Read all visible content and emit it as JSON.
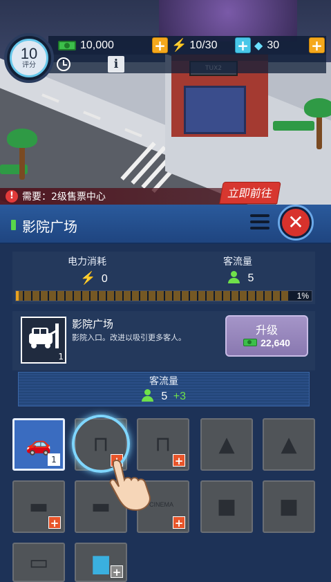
{
  "hud": {
    "rating_value": "10",
    "rating_label": "评分",
    "cash": "10,000",
    "energy": "10/30",
    "gems": "30",
    "info_symbol": "i"
  },
  "requirement": {
    "text": "需要：2级售票中心",
    "go_label": "立即前往"
  },
  "panel": {
    "title": "影院广场",
    "stats": {
      "power_label": "电力消耗",
      "power_value": "0",
      "visitors_label": "客流量",
      "visitors_value": "5",
      "progress_percent": 1,
      "progress_text": "1%"
    },
    "building": {
      "name": "影院广场",
      "description": "影院入口。改进以吸引更多客人。",
      "level": "1",
      "upgrade_label": "升级",
      "upgrade_cost": "22,640"
    },
    "flow": {
      "label": "客流量",
      "value": "5",
      "bonus": "+3"
    },
    "slots": [
      {
        "name": "slot-car-entrance",
        "icon": "car-icon",
        "level": "1",
        "state": "owned"
      },
      {
        "name": "slot-awning",
        "icon": "awning-icon",
        "state": "available"
      },
      {
        "name": "slot-awning-2",
        "icon": "awning-icon",
        "state": "available"
      },
      {
        "name": "slot-car-tree",
        "icon": "car-tree-icon",
        "state": "locked"
      },
      {
        "name": "slot-car-tree-2",
        "icon": "car-tree-icon",
        "state": "locked"
      },
      {
        "name": "slot-parking",
        "icon": "parking-icon",
        "state": "available"
      },
      {
        "name": "slot-parking-2",
        "icon": "parking-icon",
        "state": "locked"
      },
      {
        "name": "slot-cinema-sign",
        "icon": "cinema-sign-icon",
        "state": "available",
        "sign_text": "CINEMA"
      },
      {
        "name": "slot-robot",
        "icon": "robot-icon",
        "state": "locked"
      },
      {
        "name": "slot-robot-2",
        "icon": "robot-icon",
        "state": "locked"
      },
      {
        "name": "slot-billboard",
        "icon": "billboard-icon",
        "state": "locked"
      },
      {
        "name": "slot-food-truck",
        "icon": "food-truck-icon",
        "state": "available"
      }
    ]
  },
  "colors": {
    "panel_bg": "#1d3257",
    "header_bg": "#2a5a9c",
    "accent_green": "#6fe04a",
    "close_red": "#d8322c",
    "upgrade_purple": "#a595c8",
    "go_red": "#d7372f"
  }
}
